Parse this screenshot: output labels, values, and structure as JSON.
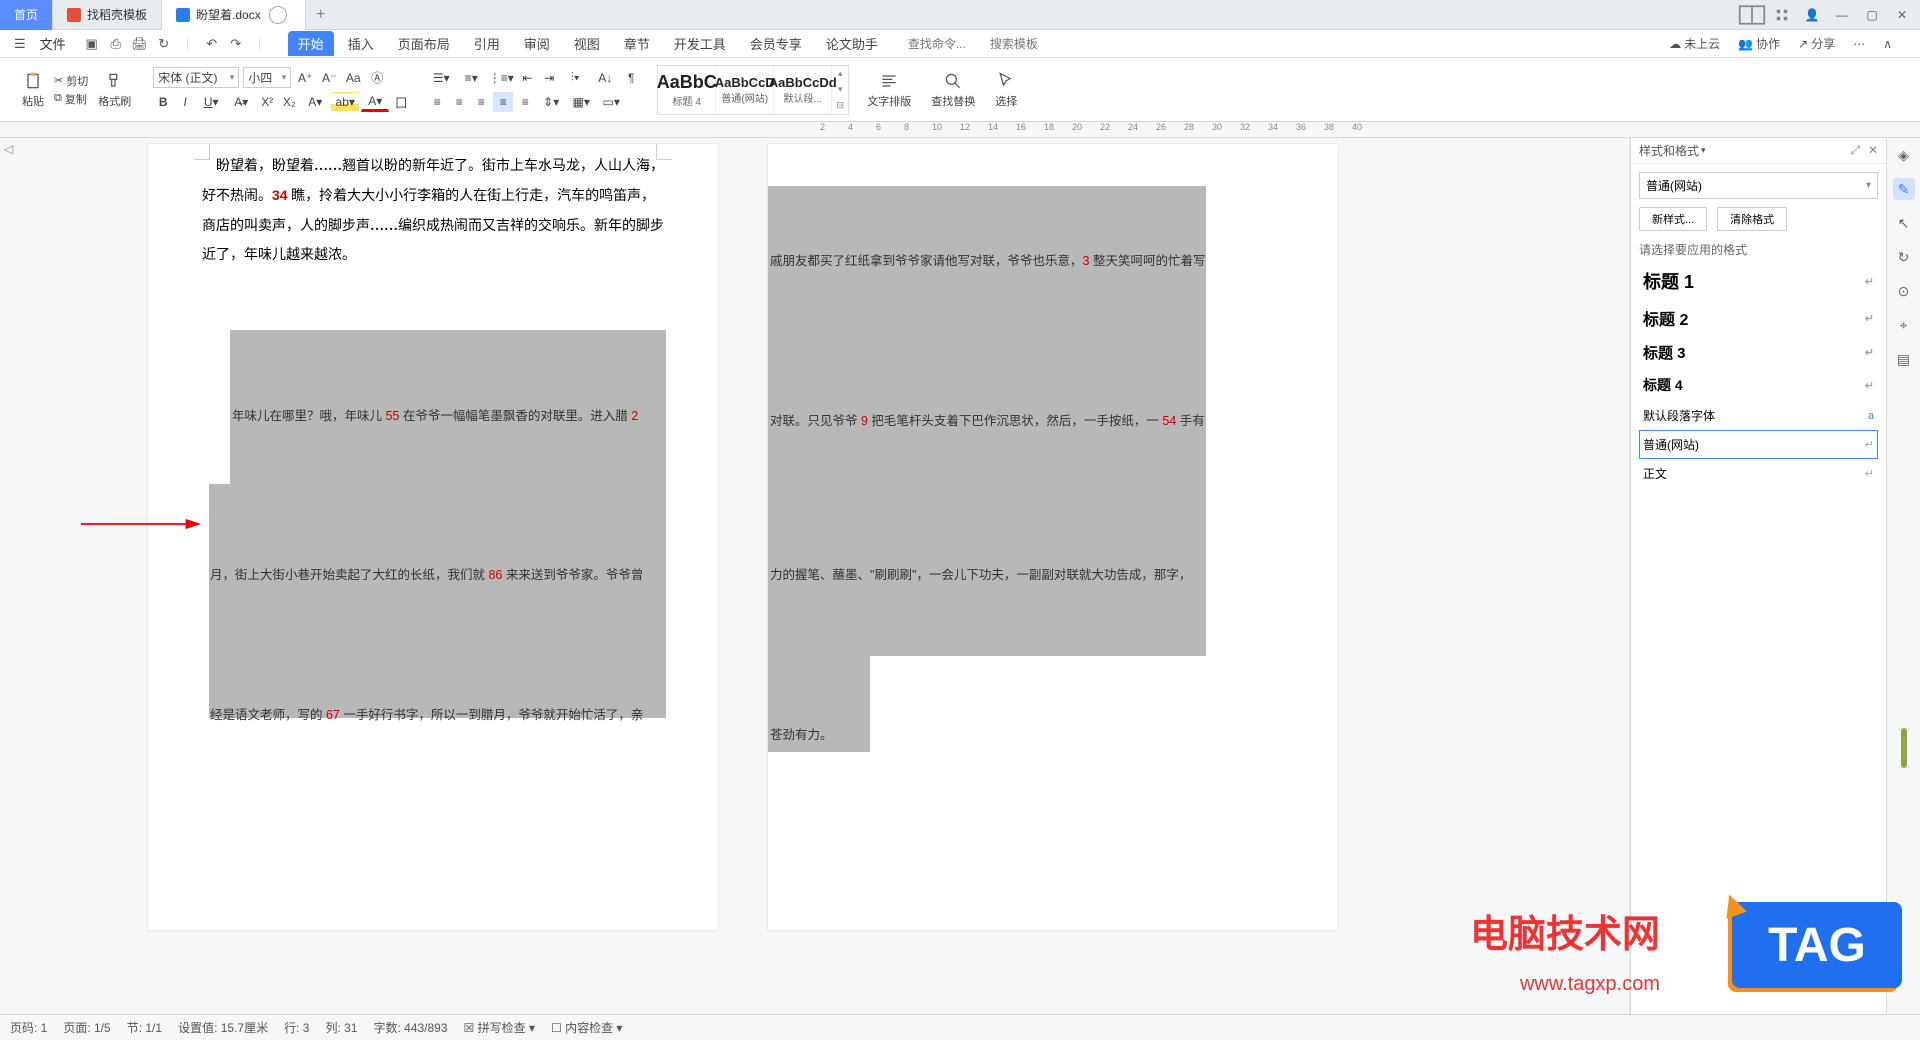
{
  "tabs": {
    "home": "首页",
    "template": "找稻壳模板",
    "doc": "盼望着.docx"
  },
  "menu": {
    "file": "文件",
    "items": [
      "开始",
      "插入",
      "页面布局",
      "引用",
      "审阅",
      "视图",
      "章节",
      "开发工具",
      "会员专享",
      "论文助手"
    ],
    "search_cmd": "查找命令...",
    "search_tpl": "搜索模板",
    "cloud": "未上云",
    "coop": "协作",
    "share": "分享"
  },
  "ribbon": {
    "paste": "粘贴",
    "cut": "剪切",
    "copy": "复制",
    "brush": "格式刷",
    "font_name": "宋体 (正文)",
    "font_size": "小四",
    "styles": [
      {
        "preview": "AaBbC",
        "name": "标题 4"
      },
      {
        "preview": "AaBbCcD",
        "name": "普通(网站)"
      },
      {
        "preview": "AaBbCcDd",
        "name": "默认段..."
      }
    ],
    "text_layout": "文字排版",
    "find_replace": "查找替换",
    "select": "选择"
  },
  "document": {
    "para1": "盼望着，盼望着……翘首以盼的新年近了。街市上车水马龙，人山人海，好不热闹。34 瞧，拎着大大小小行李箱的人在街上行走，汽车的鸣笛声，商店的叫卖声，人的脚步声……编织成热闹而又吉祥的交响乐。新年的脚步近了，年味儿越来越浓。",
    "line_p1_1": "年味儿在哪里？哦，年味儿 55 在爷爷一幅幅笔墨飘香的对联里。进入腊 2",
    "line_p1_2": "月，街上大街小巷开始卖起了大红的长纸，我们就 86 来来送到爷爷家。爷爷曾",
    "line_p1_3": "经是语文老师，写的 67 一手好行书字，所以一到腊月，爷爷就开始忙活了，亲",
    "line_p2_1": "戚朋友都买了红纸拿到爷爷家请他写对联，爷爷也乐意，3 整天笑呵呵的忙着写",
    "line_p2_2": "对联。只见爷爷 9 把毛笔杆头支着下巴作沉思状，然后，一手按纸，一 54 手有",
    "line_p2_3": "力的握笔、蘸墨、\"刷刷刷\"，一会儿下功夫，一副副对联就大功告成，那字，",
    "line_p2_4": "苍劲有力。"
  },
  "side": {
    "title": "样式和格式",
    "current": "普通(网站)",
    "new_style": "新样式...",
    "clear": "清除格式",
    "choose": "请选择要应用的格式",
    "h1": "标题 1",
    "h2": "标题 2",
    "h3": "标题 3",
    "h4": "标题 4",
    "default_font": "默认段落字体",
    "normal_web": "普通(网站)",
    "body": "正文"
  },
  "status": {
    "page_no": "页码: 1",
    "page": "页面: 1/5",
    "section": "节: 1/1",
    "pos": "设置值: 15.7厘米",
    "line": "行: 3",
    "col": "列: 31",
    "words": "字数: 443/893",
    "spell": "拼写检查",
    "content": "内容检查"
  },
  "watermark": {
    "title": "电脑技术网",
    "url": "www.tagxp.com",
    "tag": "TAG"
  },
  "ruler_nums": [
    "2",
    "4",
    "6",
    "8",
    "10",
    "12",
    "14",
    "16",
    "18",
    "20",
    "22",
    "24",
    "26",
    "28",
    "30",
    "32",
    "34",
    "36",
    "38",
    "40"
  ]
}
